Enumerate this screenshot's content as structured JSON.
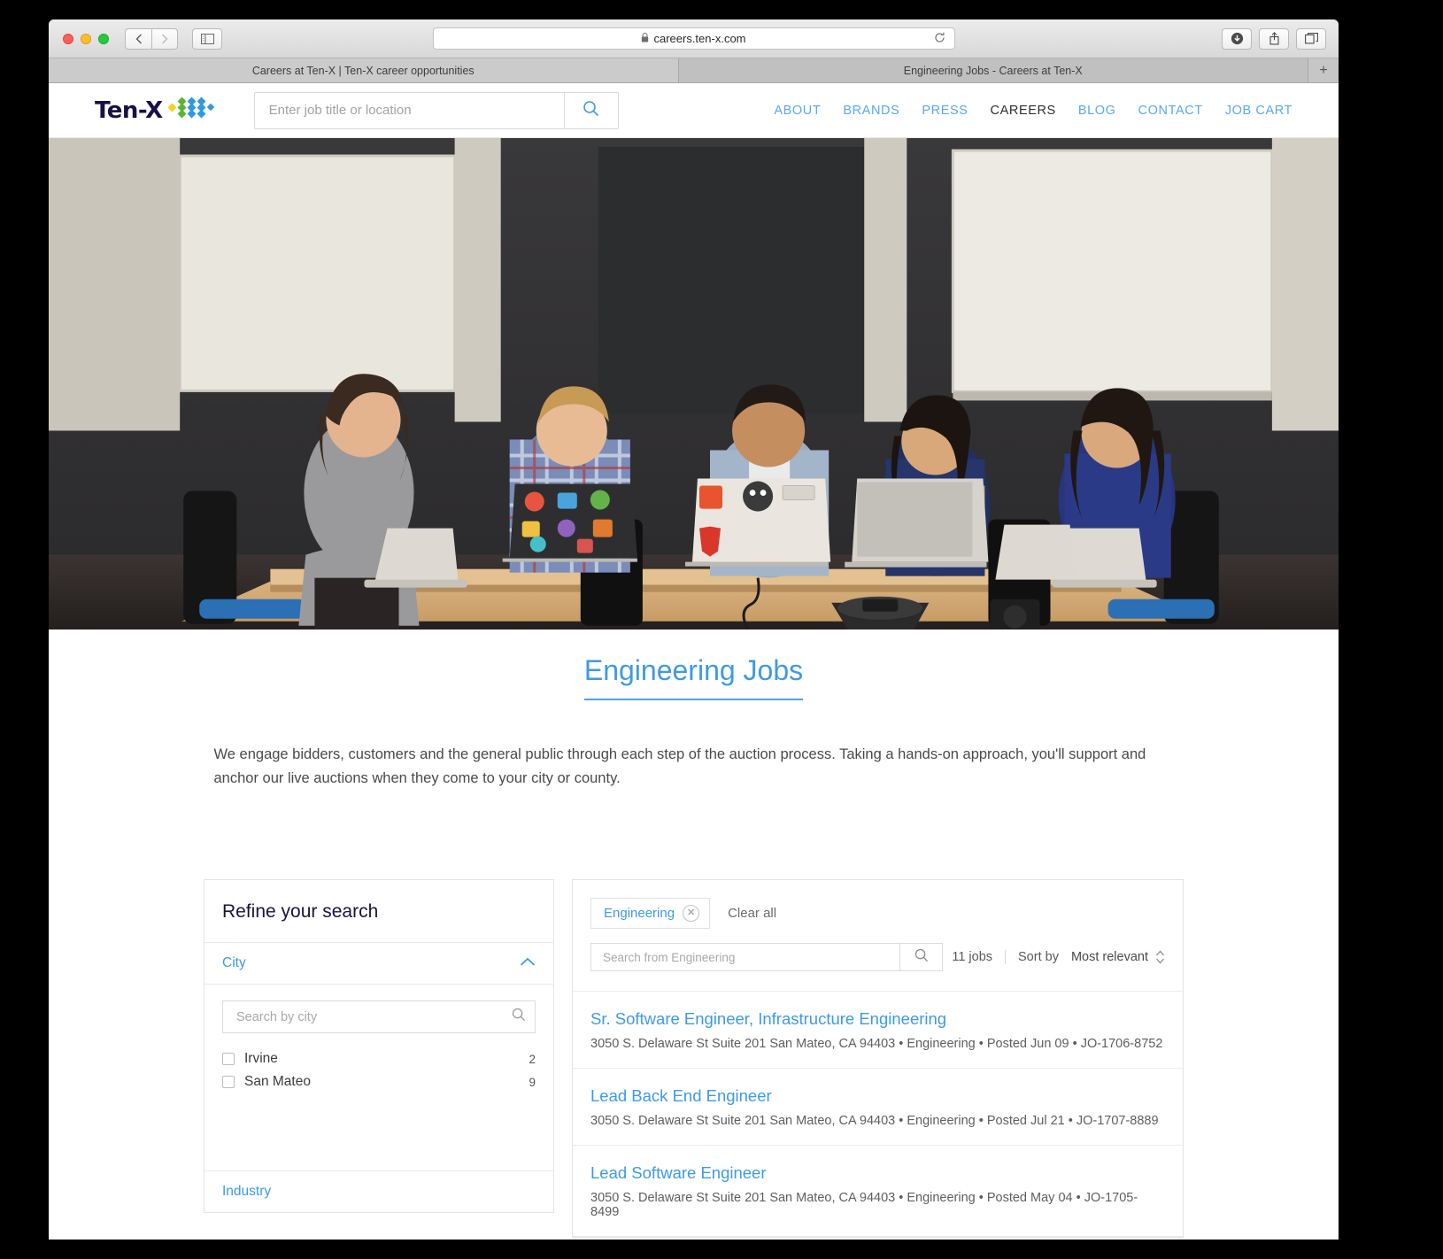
{
  "browser": {
    "url": "careers.ten-x.com",
    "lock_icon": "lock-icon",
    "reload_icon": "reload-icon",
    "back_icon": "chevron-left-icon",
    "forward_icon": "chevron-right-icon",
    "sidebar_icon": "sidebar-toggle-icon",
    "download_icon": "download-icon",
    "share_icon": "share-icon",
    "tabs_icon": "show-all-tabs-icon",
    "new_tab_label": "+",
    "tabs": [
      {
        "label": "Careers at Ten-X | Ten-X career opportunities",
        "active": false
      },
      {
        "label": "Engineering Jobs - Careers at Ten-X",
        "active": true
      }
    ]
  },
  "site_header": {
    "logo_text": "Ten-X",
    "search_placeholder": "Enter job title or location",
    "search_value": "",
    "search_icon": "search-icon",
    "nav": [
      {
        "label": "ABOUT",
        "active": false
      },
      {
        "label": "BRANDS",
        "active": false
      },
      {
        "label": "PRESS",
        "active": false
      },
      {
        "label": "CAREERS",
        "active": true
      },
      {
        "label": "BLOG",
        "active": false
      },
      {
        "label": "CONTACT",
        "active": false
      },
      {
        "label": "JOB CART",
        "active": false
      }
    ]
  },
  "hero": {
    "alt": "Five colleagues working on laptops around a conference table"
  },
  "page": {
    "title": "Engineering Jobs",
    "intro": "We engage bidders, customers and the general public through each step of the auction process. Taking a hands-on approach, you'll support and anchor our live auctions when they come to your city or county."
  },
  "sidebar": {
    "title": "Refine your search",
    "facets": [
      {
        "label": "City",
        "expanded": true,
        "chevron": "chevron-up-icon",
        "search_placeholder": "Search by city",
        "search_value": "",
        "search_icon": "search-icon",
        "options": [
          {
            "label": "Irvine",
            "count": "2",
            "checked": false
          },
          {
            "label": "San Mateo",
            "count": "9",
            "checked": false
          }
        ]
      }
    ],
    "next_facet_label": "Industry"
  },
  "results": {
    "chips": [
      {
        "label": "Engineering",
        "remove_icon": "close-circle-icon"
      }
    ],
    "clear_all_label": "Clear all",
    "search_placeholder": "Search from Engineering",
    "search_value": "",
    "search_icon": "search-icon",
    "job_count_label": "11 jobs",
    "sort_by_label": "Sort by",
    "sort_value": "Most relevant",
    "sort_icon": "sort-updown-icon",
    "jobs": [
      {
        "title": "Sr. Software Engineer, Infrastructure Engineering",
        "meta": "3050 S. Delaware St Suite 201 San Mateo, CA 94403 • Engineering • Posted Jun 09 • JO-1706-8752"
      },
      {
        "title": "Lead Back End Engineer",
        "meta": "3050 S. Delaware St Suite 201 San Mateo, CA 94403 • Engineering • Posted Jul 21 • JO-1707-8889"
      },
      {
        "title": "Lead Software Engineer",
        "meta": "3050 S. Delaware St Suite 201 San Mateo, CA 94403 • Engineering • Posted May 04 • JO-1705-8499"
      }
    ]
  },
  "colors": {
    "link_blue": "#3d9ae8",
    "nav_blue": "#57a9f0",
    "brand_navy": "#1a1046",
    "logo_green": "#5cb531",
    "logo_blue": "#2e9ae0",
    "logo_yellow": "#f5d020"
  }
}
